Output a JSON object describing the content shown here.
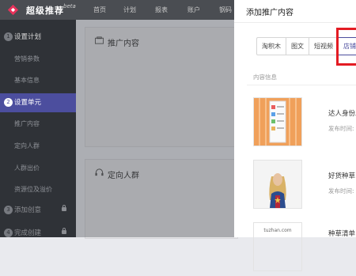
{
  "app": {
    "brand": "超级推荐",
    "beta": "beta"
  },
  "nav": {
    "items": [
      "首页",
      "计划",
      "报表",
      "账户",
      "钢码"
    ]
  },
  "sidebar": {
    "steps": [
      {
        "num": "1",
        "label": "设置计划",
        "subs": [
          "营销参数",
          "基本信息"
        ]
      },
      {
        "num": "2",
        "label": "设置单元",
        "subs": [
          "推广内容",
          "定向人群",
          "人群出价",
          "资源位及溢价"
        ]
      },
      {
        "num": "3",
        "label": "添加创意",
        "subs": []
      },
      {
        "num": "4",
        "label": "完成创建",
        "subs": []
      }
    ]
  },
  "main": {
    "panels": [
      {
        "title": "推广内容",
        "icon": "folder-icon"
      },
      {
        "title": "定向人群",
        "icon": "headset-icon"
      }
    ]
  },
  "drawer": {
    "title": "添加推广内容",
    "tabs": [
      "淘积木",
      "图文",
      "短视频",
      "店铺"
    ],
    "active_tab": "店铺",
    "section_label": "内容信息",
    "items": [
      {
        "title": "达人身份发",
        "time_label": "发布时间:"
      },
      {
        "title": "好货种草",
        "time_label": "发布时间:"
      },
      {
        "title": "种草清单",
        "time_label": ""
      }
    ],
    "thumb_caption": "tuzhan.com"
  },
  "colors": {
    "accent": "#4c4e9e",
    "highlight": "#e31b23",
    "topbar": "#4a4d52",
    "sidebar": "#2f3237"
  }
}
